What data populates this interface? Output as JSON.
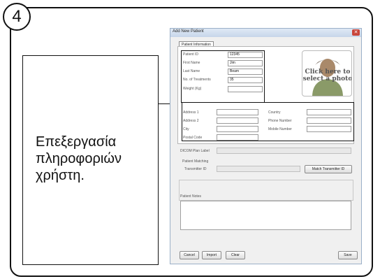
{
  "step_number": "4",
  "description": "Επεξεργασία\nπληροφοριών\nχρήστη.",
  "dialog": {
    "title": "Add New Patient",
    "close_label": "✕",
    "tab_label": "Patient Information",
    "photo_text": "Click here to select a photo",
    "fields": {
      "patient_id": {
        "label": "Patient ID",
        "value": "12345"
      },
      "first_name": {
        "label": "First Name",
        "value": "Jim"
      },
      "last_name": {
        "label": "Last Name",
        "value": "Beam"
      },
      "num_treatments": {
        "label": "No. of Treatments",
        "value": "35"
      },
      "weight": {
        "label": "Weight (Kg)",
        "value": ""
      },
      "address1": {
        "label": "Address 1",
        "value": ""
      },
      "address2": {
        "label": "Address 2",
        "value": ""
      },
      "city": {
        "label": "City",
        "value": ""
      },
      "postal_code": {
        "label": "Postal Code",
        "value": ""
      },
      "country": {
        "label": "Country",
        "value": ""
      },
      "phone": {
        "label": "Phone Number",
        "value": ""
      },
      "mobile": {
        "label": "Mobile Number",
        "value": ""
      },
      "dicom_label": {
        "label": "DICOM Plan Label",
        "value": ""
      }
    },
    "matching": {
      "group_label": "Patient Matching",
      "transmitter_label": "Transmitter ID",
      "transmitter_value": "",
      "match_button": "Match Transmitter ID"
    },
    "notes_label": "Patient Notes",
    "buttons": {
      "cancel": "Cancel",
      "import": "Import",
      "clear": "Clear",
      "save": "Save"
    }
  }
}
